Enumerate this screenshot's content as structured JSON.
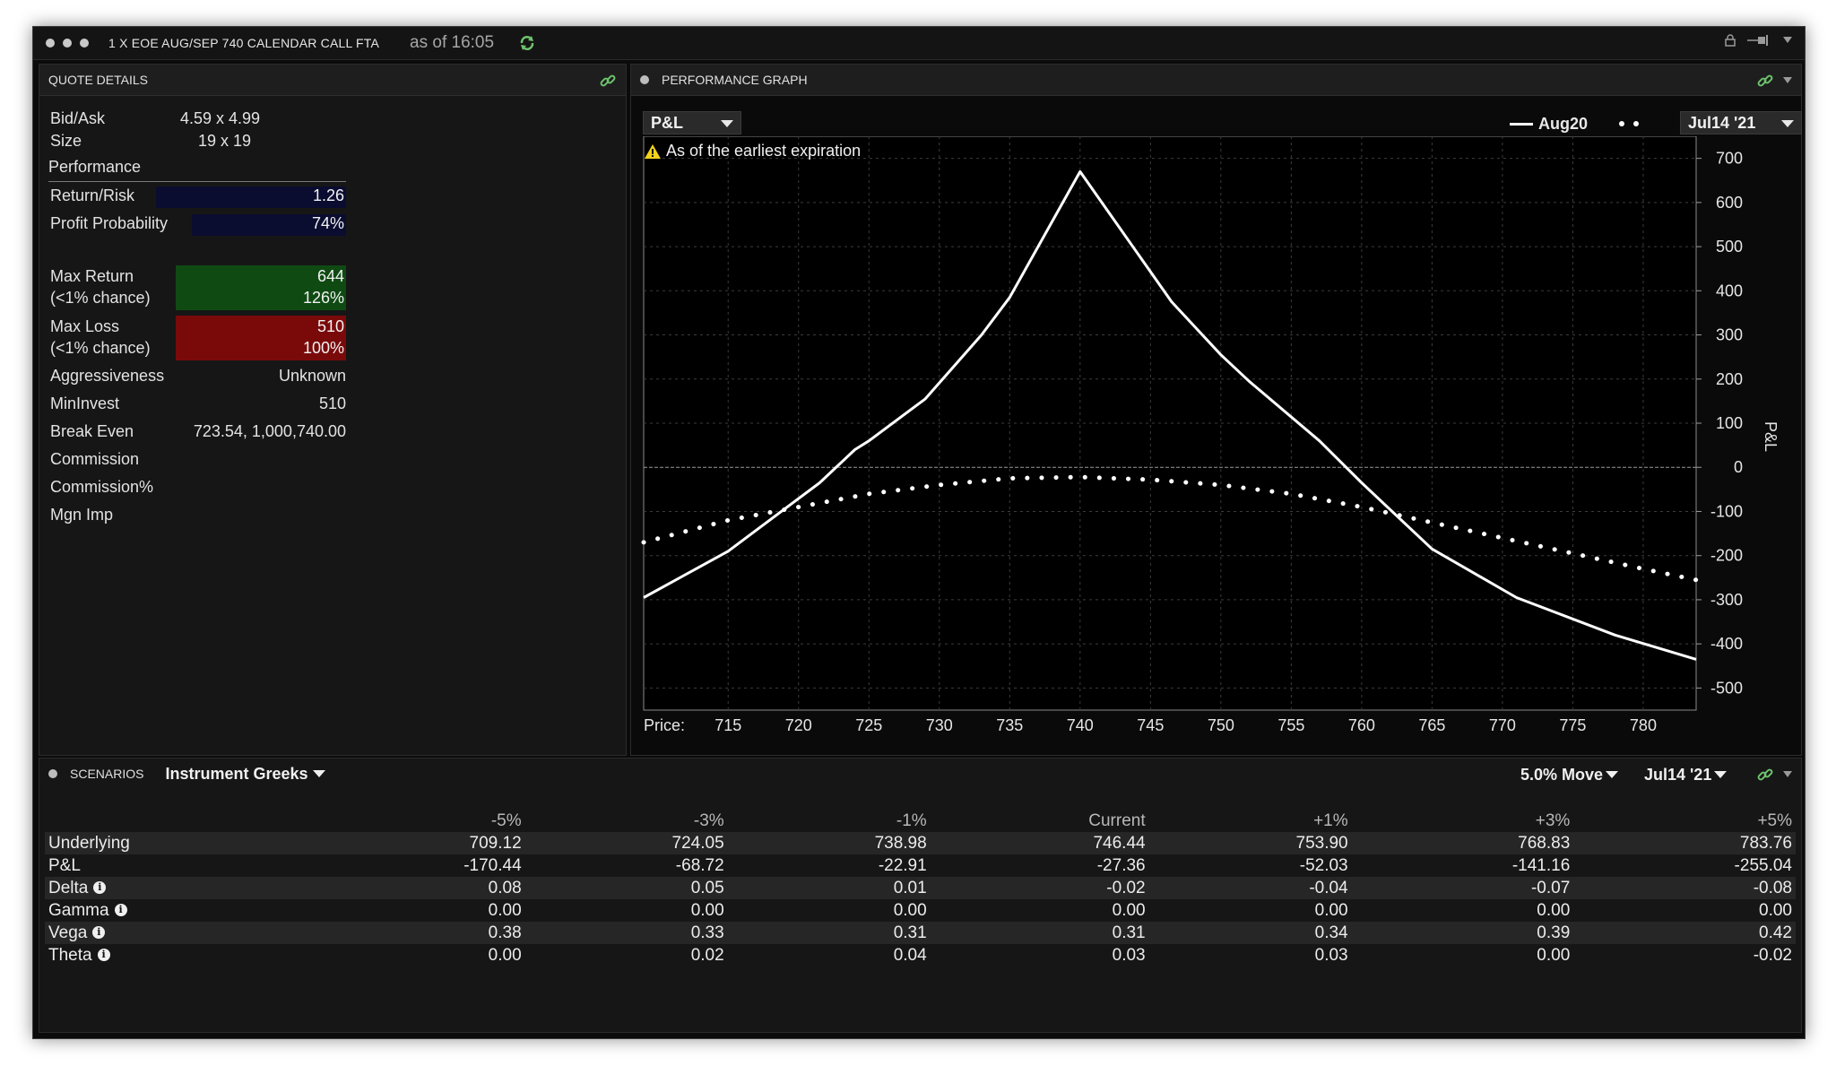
{
  "window": {
    "title": "1 X EOE AUG/SEP 740 CALENDAR CALL FTA",
    "as_of": "as of 16:05"
  },
  "quote": {
    "header": "QUOTE DETAILS",
    "bid_ask_label": "Bid/Ask",
    "bid_ask": "4.59 x 4.99",
    "size_label": "Size",
    "size": "19 x 19",
    "performance_label": "Performance",
    "return_risk_label": "Return/Risk",
    "return_risk": "1.26",
    "profit_prob_label": "Profit Probability",
    "profit_prob": "74%",
    "profit_prob_value": 0.74,
    "max_return_label": "Max Return",
    "max_return_sub": "(<1% chance)",
    "max_return": "644",
    "max_return_pct": "126%",
    "max_loss_label": "Max Loss",
    "max_loss_sub": "(<1% chance)",
    "max_loss": "510",
    "max_loss_pct": "100%",
    "aggressiveness_label": "Aggressiveness",
    "aggressiveness": "Unknown",
    "mininvest_label": "MinInvest",
    "mininvest": "510",
    "break_even_label": "Break Even",
    "break_even": "723.54, 1,000,740.00",
    "commission_label": "Commission",
    "commission_pct_label": "Commission%",
    "mgn_imp_label": "Mgn Imp",
    "colors": {
      "return_risk_bar": "#0a0c30",
      "profit_bar": "#0a0c30",
      "max_return_bar": "#0f4a12",
      "max_loss_bar": "#7a0a0a"
    }
  },
  "perf": {
    "header": "PERFORMANCE GRAPH",
    "metric_select": "P&L",
    "legend_series1": "Aug20",
    "date_select": "Jul14 '21",
    "warning": "As of the earliest expiration",
    "price_label": "Price:"
  },
  "chart_data": {
    "type": "line",
    "ylabel": "P&L",
    "xlim": [
      709,
      783.76
    ],
    "ylim": [
      -550,
      750
    ],
    "x_ticks": [
      715,
      720,
      725,
      730,
      735,
      740,
      745,
      750,
      755,
      760,
      765,
      770,
      775,
      780
    ],
    "y_ticks": [
      700,
      600,
      500,
      400,
      300,
      200,
      100,
      0,
      -100,
      -200,
      -300,
      -400,
      -500
    ],
    "series": [
      {
        "name": "Aug20",
        "style": "solid",
        "color": "#ffffff",
        "x": [
          709,
          715,
          721.5,
          724,
          725,
          729,
          733,
          735,
          740,
          746.5,
          750,
          752,
          757,
          760,
          765,
          771,
          778,
          783.76
        ],
        "y": [
          -295,
          -190,
          -35,
          40,
          60,
          155,
          300,
          385,
          670,
          375,
          255,
          195,
          60,
          -35,
          -185,
          -295,
          -380,
          -435
        ]
      },
      {
        "name": "",
        "style": "dotted",
        "color": "#ffffff",
        "x": [
          709,
          712,
          715,
          720,
          725,
          730,
          735,
          740,
          745,
          750,
          755,
          760,
          765,
          770,
          775,
          780,
          783.76
        ],
        "y": [
          -170,
          -145,
          -120,
          -90,
          -60,
          -40,
          -25,
          -22,
          -28,
          -40,
          -60,
          -90,
          -125,
          -160,
          -195,
          -230,
          -255
        ]
      }
    ]
  },
  "scenarios": {
    "header": "SCENARIOS",
    "mode": "Instrument Greeks",
    "move": "5.0% Move",
    "date": "Jul14 '21",
    "columns": [
      "-5%",
      "-3%",
      "-1%",
      "Current",
      "+1%",
      "+3%",
      "+5%"
    ],
    "rows": [
      {
        "label": "Underlying",
        "info": false,
        "values": [
          "709.12",
          "724.05",
          "738.98",
          "746.44",
          "753.90",
          "768.83",
          "783.76"
        ]
      },
      {
        "label": "P&L",
        "info": false,
        "values": [
          "-170.44",
          "-68.72",
          "-22.91",
          "-27.36",
          "-52.03",
          "-141.16",
          "-255.04"
        ]
      },
      {
        "label": "Delta",
        "info": true,
        "values": [
          "0.08",
          "0.05",
          "0.01",
          "-0.02",
          "-0.04",
          "-0.07",
          "-0.08"
        ]
      },
      {
        "label": "Gamma",
        "info": true,
        "values": [
          "0.00",
          "0.00",
          "0.00",
          "0.00",
          "0.00",
          "0.00",
          "0.00"
        ]
      },
      {
        "label": "Vega",
        "info": true,
        "values": [
          "0.38",
          "0.33",
          "0.31",
          "0.31",
          "0.34",
          "0.39",
          "0.42"
        ]
      },
      {
        "label": "Theta",
        "info": true,
        "values": [
          "0.00",
          "0.02",
          "0.04",
          "0.03",
          "0.03",
          "0.00",
          "-0.02"
        ]
      }
    ]
  }
}
